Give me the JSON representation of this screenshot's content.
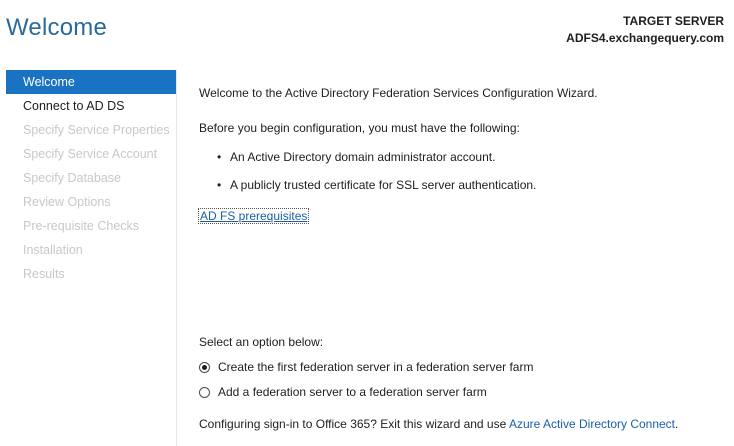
{
  "header": {
    "title": "Welcome",
    "target_server_label": "TARGET SERVER",
    "target_server_name": "ADFS4.exchangequery.com"
  },
  "nav": {
    "items": [
      {
        "label": "Welcome",
        "state": "selected"
      },
      {
        "label": "Connect to AD DS",
        "state": "enabled"
      },
      {
        "label": "Specify Service Properties",
        "state": "disabled"
      },
      {
        "label": "Specify Service Account",
        "state": "disabled"
      },
      {
        "label": "Specify Database",
        "state": "disabled"
      },
      {
        "label": "Review Options",
        "state": "disabled"
      },
      {
        "label": "Pre-requisite Checks",
        "state": "disabled"
      },
      {
        "label": "Installation",
        "state": "disabled"
      },
      {
        "label": "Results",
        "state": "disabled"
      }
    ]
  },
  "main": {
    "intro": "Welcome to the Active Directory Federation Services Configuration Wizard.",
    "requirements_heading": "Before you begin configuration, you must have the following:",
    "requirements": [
      "An Active Directory domain administrator account.",
      "A publicly trusted certificate for SSL server authentication."
    ],
    "prereq_link": "AD FS prerequisites",
    "option_prompt": "Select an option below:",
    "options": [
      {
        "label": "Create the first federation server in a federation server farm",
        "selected": true
      },
      {
        "label": "Add a federation server to a federation server farm",
        "selected": false
      }
    ],
    "office_text": "Configuring sign-in to Office 365? Exit this wizard and use ",
    "office_link": "Azure Active Directory Connect",
    "office_suffix": "."
  }
}
